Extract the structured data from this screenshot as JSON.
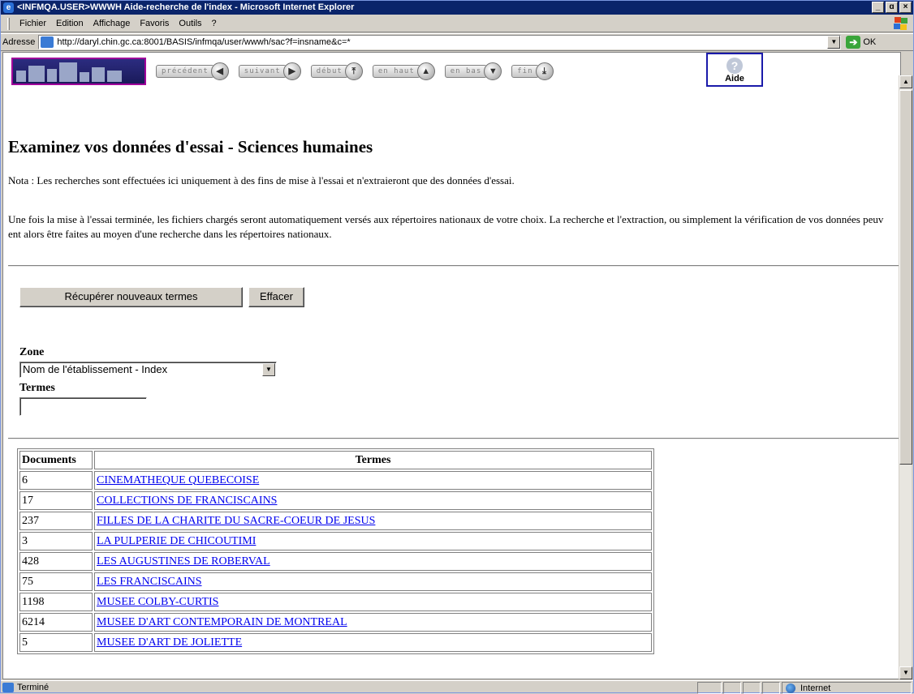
{
  "window": {
    "title": "<INFMQA.USER>WWWH Aide-recherche de l'index - Microsoft Internet Explorer",
    "controls": [
      "_",
      "ɑ",
      "×"
    ]
  },
  "menu": [
    "Fichier",
    "Edition",
    "Affichage",
    "Favoris",
    "Outils",
    "?"
  ],
  "address": {
    "label": "Adresse",
    "url": "http://daryl.chin.gc.ca:8001/BASIS/infmqa/user/wwwh/sac?f=insname&c=*",
    "go_label": "OK"
  },
  "nav": {
    "buttons": [
      {
        "label": "précédent",
        "icon": "arrow-left-icon",
        "glyph": "◀"
      },
      {
        "label": "suivant",
        "icon": "arrow-right-icon",
        "glyph": "▶"
      },
      {
        "label": "début",
        "icon": "arrow-top-icon",
        "glyph": "⤒"
      },
      {
        "label": "en haut",
        "icon": "arrow-up-icon",
        "glyph": "▲"
      },
      {
        "label": "en bas",
        "icon": "arrow-down-icon",
        "glyph": "▼"
      },
      {
        "label": "fin",
        "icon": "arrow-end-icon",
        "glyph": "⤓"
      }
    ],
    "help_label": "Aide"
  },
  "page": {
    "title": "Examinez vos données d'essai - Sciences humaines",
    "note": "Nota : Les recherches sont effectuées ici uniquement à des fins de mise à l'essai et n'extraieront que des données d'essai.",
    "paragraph": "Une fois la mise à l'essai terminée, les fichiers chargés seront automatiquement versés aux répertoires nationaux de votre choix. La recherche et l'extraction, ou simplement la vérification de vos données peuv ent alors être faites au moyen d'une recherche dans les répertoires nationaux."
  },
  "form": {
    "fetch_button": "Récupérer nouveaux termes",
    "clear_button": "Effacer",
    "zone_label": "Zone",
    "zone_value": "Nom de l'établissement - Index",
    "terms_label": "Termes",
    "terms_value": ""
  },
  "table": {
    "headers": [
      "Documents",
      "Termes"
    ],
    "rows": [
      {
        "count": "6",
        "term": "CINEMATHEQUE QUEBECOISE"
      },
      {
        "count": "17",
        "term": "COLLECTIONS DE FRANCISCAINS"
      },
      {
        "count": "237",
        "term": "FILLES DE LA CHARITE DU SACRE-COEUR DE JESUS"
      },
      {
        "count": "3",
        "term": "LA PULPERIE DE CHICOUTIMI"
      },
      {
        "count": "428",
        "term": "LES AUGUSTINES DE ROBERVAL"
      },
      {
        "count": "75",
        "term": "LES FRANCISCAINS"
      },
      {
        "count": "1198",
        "term": "MUSEE COLBY-CURTIS"
      },
      {
        "count": "6214",
        "term": "MUSEE D'ART CONTEMPORAIN DE MONTREAL"
      },
      {
        "count": "5",
        "term": "MUSEE D'ART DE JOLIETTE"
      }
    ]
  },
  "status": {
    "text": "Terminé",
    "zone": "Internet"
  },
  "colors": {
    "titlebar": "#0a246a",
    "link": "#0000ee",
    "chrome": "#d4d0c8"
  }
}
